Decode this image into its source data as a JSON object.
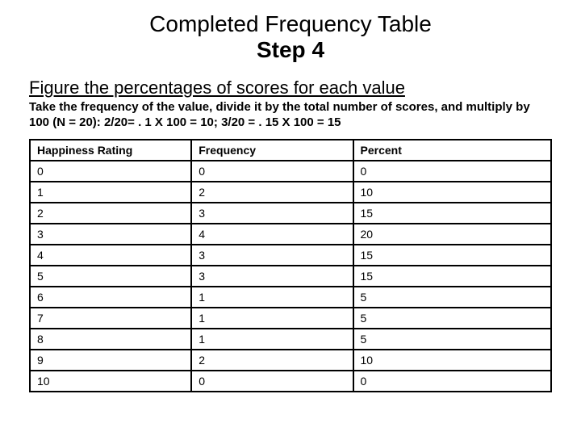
{
  "title": {
    "line1": "Completed Frequency Table",
    "line2": "Step 4"
  },
  "instruction": {
    "main": "Figure the percentages of scores for each value",
    "sub": "Take the frequency of the value, divide it by the total number of scores, and multiply by 100 (N = 20):  2/20= . 1 X 100 = 10; 3/20 = . 15 X 100 = 15"
  },
  "table": {
    "headers": {
      "c1": "Happiness Rating",
      "c2": "Frequency",
      "c3": "Percent"
    },
    "rows": [
      {
        "c1": "0",
        "c2": "0",
        "c3": "0"
      },
      {
        "c1": "1",
        "c2": "2",
        "c3": "10"
      },
      {
        "c1": "2",
        "c2": "3",
        "c3": "15"
      },
      {
        "c1": "3",
        "c2": "4",
        "c3": "20"
      },
      {
        "c1": "4",
        "c2": "3",
        "c3": "15"
      },
      {
        "c1": "5",
        "c2": "3",
        "c3": "15"
      },
      {
        "c1": "6",
        "c2": "1",
        "c3": "5"
      },
      {
        "c1": "7",
        "c2": "1",
        "c3": "5"
      },
      {
        "c1": "8",
        "c2": "1",
        "c3": "5"
      },
      {
        "c1": "9",
        "c2": "2",
        "c3": "10"
      },
      {
        "c1": "10",
        "c2": "0",
        "c3": "0"
      }
    ]
  },
  "chart_data": {
    "type": "table",
    "title": "Completed Frequency Table Step 4",
    "columns": [
      "Happiness Rating",
      "Frequency",
      "Percent"
    ],
    "rows": [
      [
        0,
        0,
        0
      ],
      [
        1,
        2,
        10
      ],
      [
        2,
        3,
        15
      ],
      [
        3,
        4,
        20
      ],
      [
        4,
        3,
        15
      ],
      [
        5,
        3,
        15
      ],
      [
        6,
        1,
        5
      ],
      [
        7,
        1,
        5
      ],
      [
        8,
        1,
        5
      ],
      [
        9,
        2,
        10
      ],
      [
        10,
        0,
        0
      ]
    ],
    "n": 20
  }
}
